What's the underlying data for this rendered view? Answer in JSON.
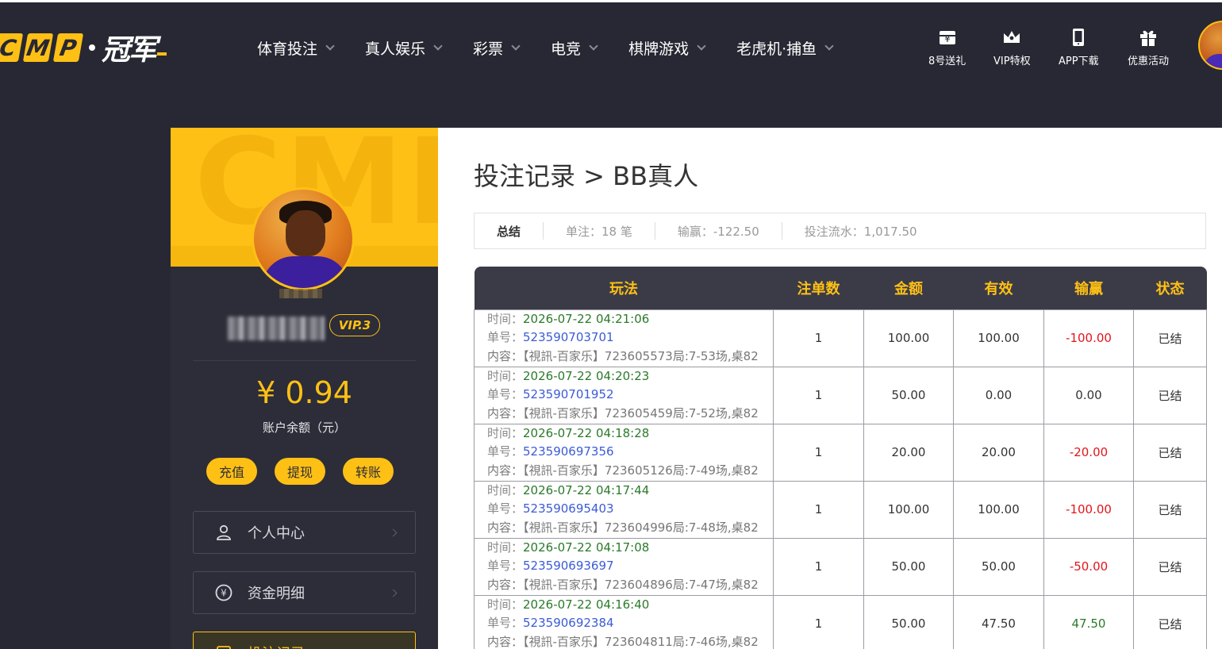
{
  "brand": {
    "letters": [
      "C",
      "M",
      "P"
    ],
    "name_cn": "冠军"
  },
  "nav": [
    {
      "label": "体育投注"
    },
    {
      "label": "真人娱乐"
    },
    {
      "label": "彩票"
    },
    {
      "label": "电竞"
    },
    {
      "label": "棋牌游戏"
    },
    {
      "label": "老虎机·捕鱼"
    }
  ],
  "quick_links": [
    {
      "label": "8号送礼",
      "icon": "gift-box-icon"
    },
    {
      "label": "VIP特权",
      "icon": "crown-icon"
    },
    {
      "label": "APP下载",
      "icon": "mobile-icon"
    },
    {
      "label": "优惠活动",
      "icon": "present-icon"
    }
  ],
  "profile": {
    "banner_text": "CMP",
    "vip_label": "VIP.3",
    "balance": "¥ 0.94",
    "balance_label": "账户余额（元）",
    "actions": [
      "充值",
      "提现",
      "转账"
    ],
    "menu": [
      {
        "label": "个人中心",
        "icon": "user-icon"
      },
      {
        "label": "资金明细",
        "icon": "yuan-circle-icon"
      },
      {
        "label": "投注记录",
        "icon": "list-icon"
      }
    ]
  },
  "page": {
    "title": "投注记录 > BB真人"
  },
  "summary": {
    "label": "总结",
    "bets": "单注：18 笔",
    "winloss": "输赢：-122.50",
    "turnover": "投注流水：1,017.50"
  },
  "table": {
    "headers": [
      "玩法",
      "注单数",
      "金额",
      "有效",
      "输赢",
      "状态"
    ],
    "field_labels": {
      "time": "时间：",
      "order": "单号：",
      "content": "内容："
    },
    "rows": [
      {
        "time": "2026-07-22 04:21:06",
        "order": "523590703701",
        "content": "【視訊-百家乐】723605573局:7-53场,桌82",
        "count": "1",
        "amount": "100.00",
        "valid": "100.00",
        "winloss": "-100.00",
        "status": "已结"
      },
      {
        "time": "2026-07-22 04:20:23",
        "order": "523590701952",
        "content": "【視訊-百家乐】723605459局:7-52场,桌82",
        "count": "1",
        "amount": "50.00",
        "valid": "0.00",
        "winloss": "0.00",
        "status": "已结"
      },
      {
        "time": "2026-07-22 04:18:28",
        "order": "523590697356",
        "content": "【視訊-百家乐】723605126局:7-49场,桌82",
        "count": "1",
        "amount": "20.00",
        "valid": "20.00",
        "winloss": "-20.00",
        "status": "已结"
      },
      {
        "time": "2026-07-22 04:17:44",
        "order": "523590695403",
        "content": "【視訊-百家乐】723604996局:7-48场,桌82",
        "count": "1",
        "amount": "100.00",
        "valid": "100.00",
        "winloss": "-100.00",
        "status": "已结"
      },
      {
        "time": "2026-07-22 04:17:08",
        "order": "523590693697",
        "content": "【視訊-百家乐】723604896局:7-47场,桌82",
        "count": "1",
        "amount": "50.00",
        "valid": "50.00",
        "winloss": "-50.00",
        "status": "已结"
      },
      {
        "time": "2026-07-22 04:16:40",
        "order": "523590692384",
        "content": "【視訊-百家乐】723604811局:7-46场,桌82",
        "count": "1",
        "amount": "50.00",
        "valid": "47.50",
        "winloss": "47.50",
        "status": "已结"
      }
    ]
  },
  "colors": {
    "accent": "#ffc015",
    "background": "#272833",
    "negative": "#e5141b",
    "positive": "#2a7a2a",
    "link": "#3b5bd6"
  }
}
